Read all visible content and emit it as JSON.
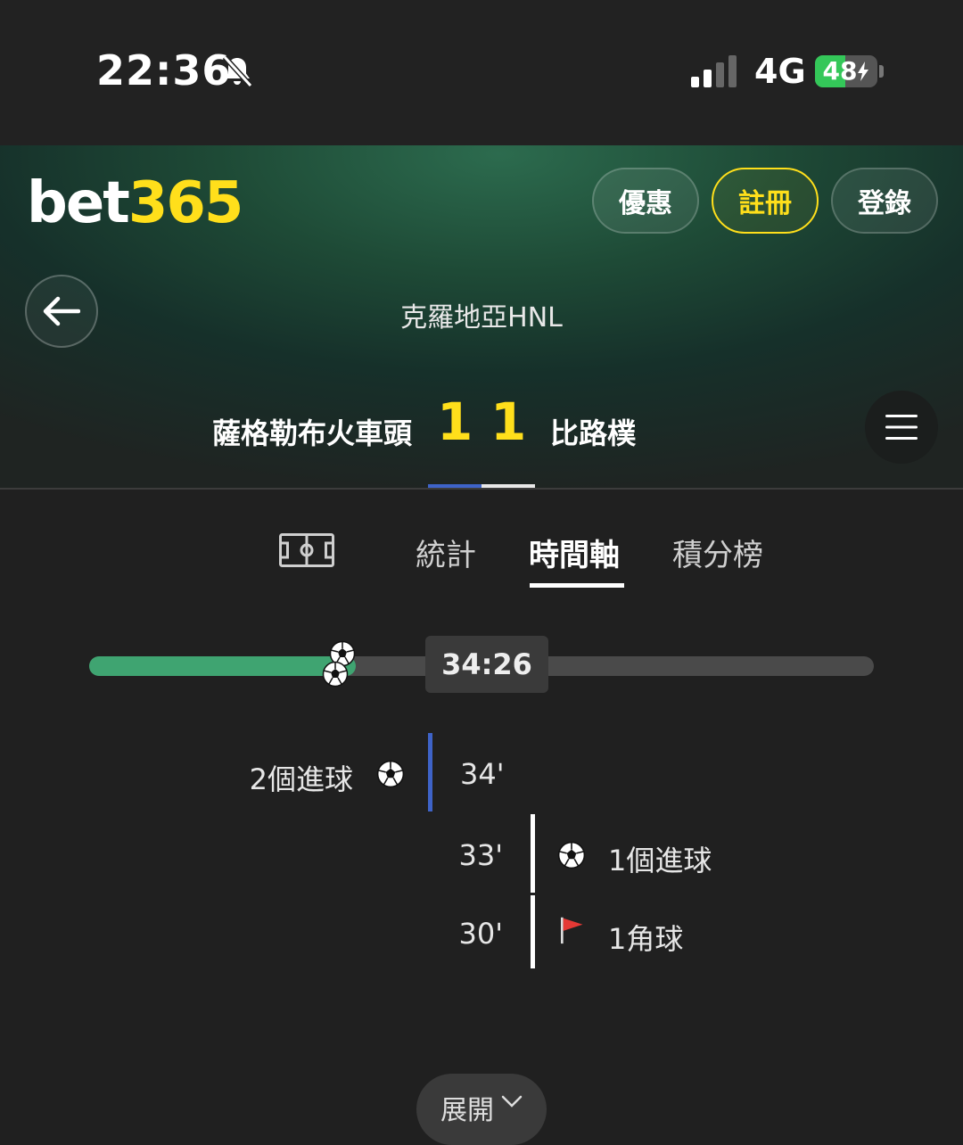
{
  "status_bar": {
    "time": "22:36",
    "network": "4G",
    "battery": "48",
    "battery_level": 0.48,
    "icons": [
      "bell-slash-icon",
      "signal-icon",
      "charging-icon"
    ]
  },
  "header": {
    "logo_a": "bet",
    "logo_b": "365",
    "buttons": {
      "offers": "優惠",
      "register": "註冊",
      "login": "登錄"
    },
    "league": "克羅地亞HNL",
    "home_team": "薩格勒布火車頭",
    "away_team": "比路樸",
    "home_score": "1",
    "away_score": "1",
    "colors": {
      "brand_yellow": "#ffdf1b",
      "home_color": "#3e63c8",
      "away_color": "#e8e8e8"
    }
  },
  "tabs": {
    "pitch_icon": "pitch-icon",
    "stats": "統計",
    "timeline": "時間軸",
    "standings": "積分榜",
    "active": "時間軸"
  },
  "match_progress": {
    "clock": "34:26",
    "progress_fraction": 0.34,
    "accent": "#3fa471"
  },
  "timeline": {
    "events": [
      {
        "minute": "34'",
        "label": "2個進球",
        "side": "home",
        "icon": "football-icon"
      },
      {
        "minute": "33'",
        "label": "1個進球",
        "side": "away",
        "icon": "football-icon"
      },
      {
        "minute": "30'",
        "label": "1角球",
        "side": "away",
        "icon": "corner-flag-icon"
      }
    ]
  },
  "expand": {
    "label": "展開"
  }
}
